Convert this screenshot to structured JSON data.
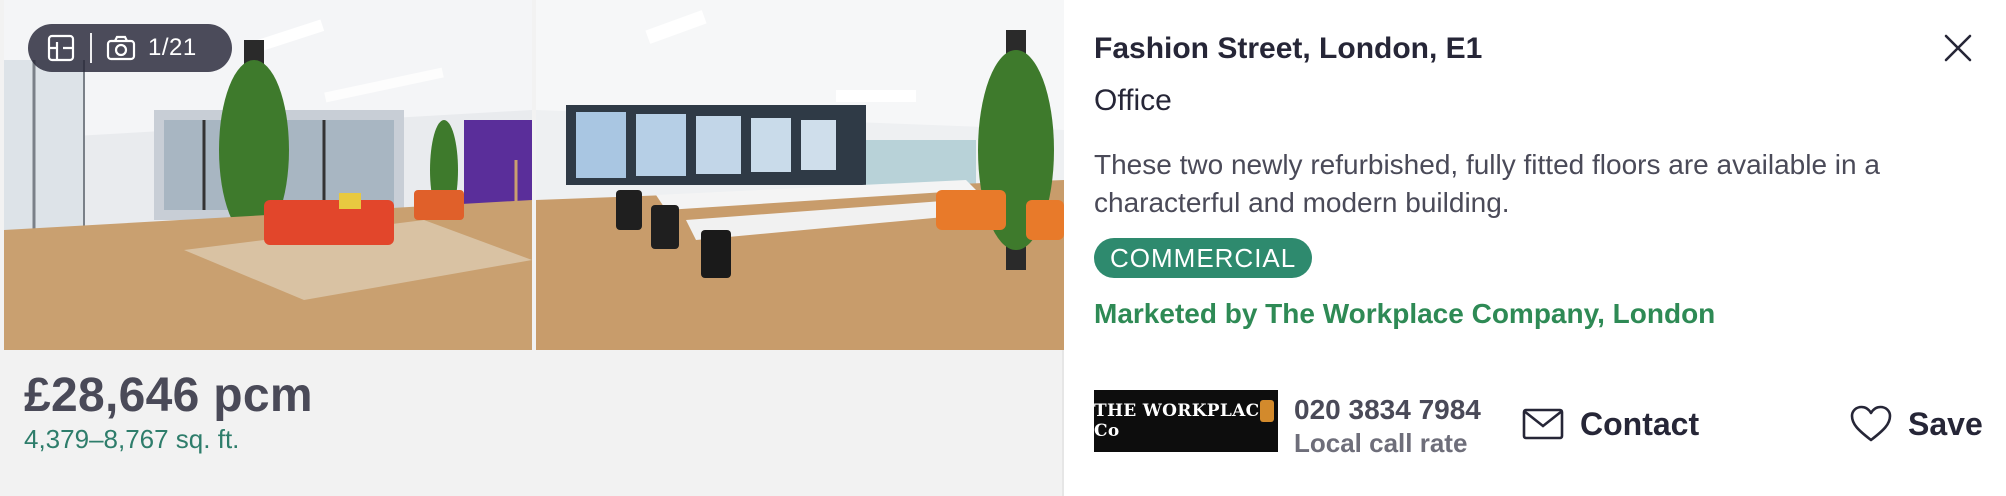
{
  "listing": {
    "address": "Fashion Street, London, E1",
    "property_type": "Office",
    "description": "These two newly refurbished, fully fitted floors are available in a characterful and modern building.",
    "badge": "COMMERCIAL",
    "marketed_by": "Marketed by The Workplace Company, London"
  },
  "gallery": {
    "photo_counter": "1/21",
    "icons": [
      "floorplan-icon",
      "camera-icon"
    ]
  },
  "pricing": {
    "price": "£28,646 pcm",
    "size": "4,379–8,767 sq. ft."
  },
  "agent": {
    "logo_text": "THE WORKPLACE Co",
    "phone": "020 3834 7984",
    "phone_note": "Local call rate"
  },
  "actions": {
    "contact_label": "Contact",
    "save_label": "Save",
    "close_icon": "close-icon"
  },
  "colors": {
    "accent_green": "#2e8a55",
    "badge_bg": "#2e8a6e",
    "size_text": "#2e7d6b",
    "text_primary": "#262637"
  }
}
